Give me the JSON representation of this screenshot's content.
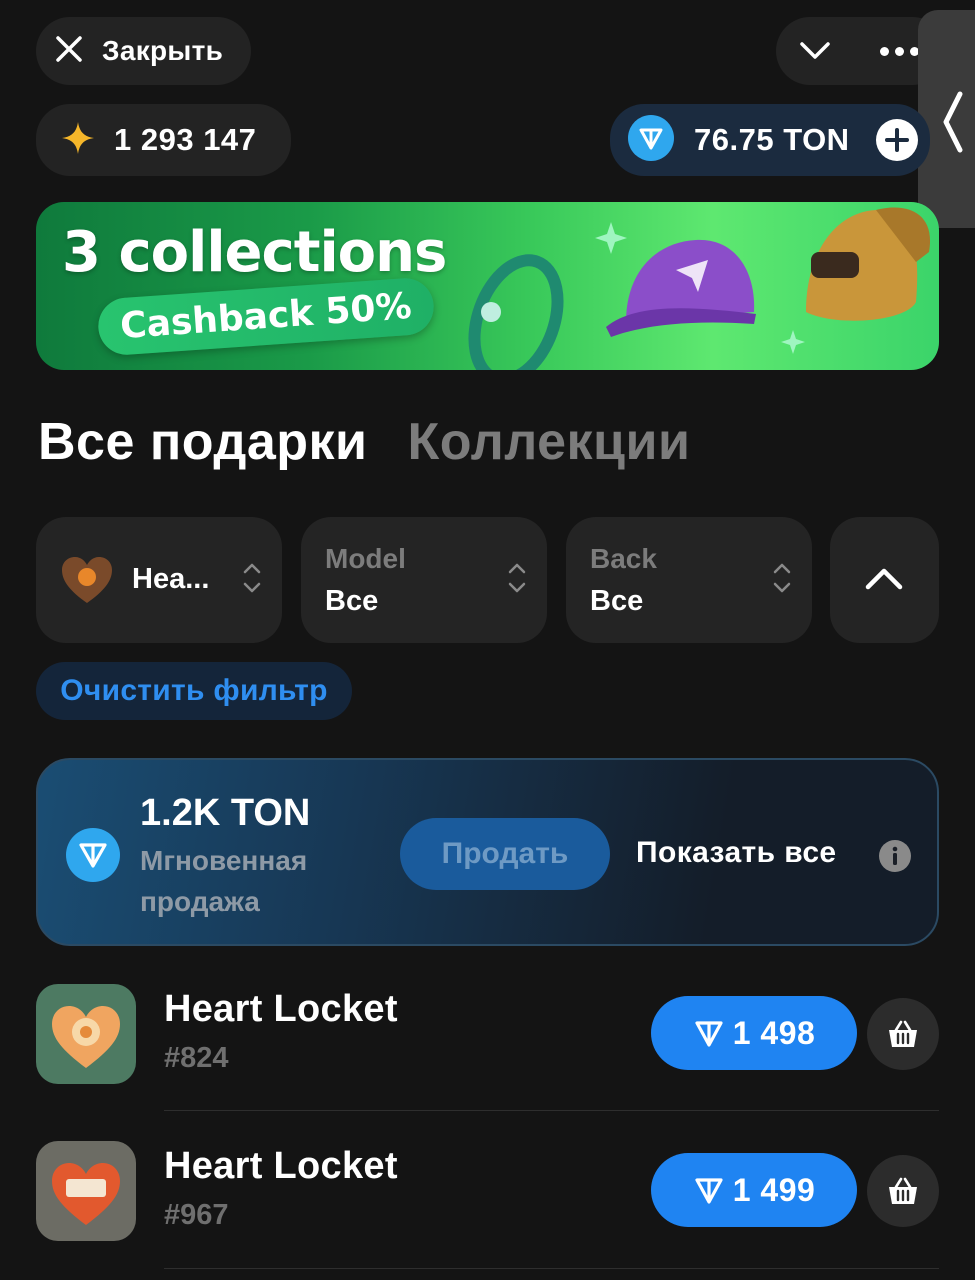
{
  "header": {
    "close_label": "Закрыть",
    "stars_balance": "1 293 147",
    "ton_balance": "76.75 TON"
  },
  "banner": {
    "title": "3 collections",
    "badge": "Cashback 50%"
  },
  "tabs": [
    {
      "label": "Все подарки",
      "active": true
    },
    {
      "label": "Коллекции",
      "active": false
    }
  ],
  "filters": {
    "collection": {
      "value": "Hea..."
    },
    "model": {
      "title": "Model",
      "value": "Все"
    },
    "back": {
      "title": "Back",
      "value": "Все"
    }
  },
  "clear_filter_label": "Очистить фильтр",
  "instant_sale": {
    "amount": "1.2K TON",
    "description": "Мгновенная продажа",
    "sell_label": "Продать",
    "show_all_label": "Показать все"
  },
  "items": [
    {
      "name": "Heart Locket",
      "number": "#824",
      "price": "1 498"
    },
    {
      "name": "Heart Locket",
      "number": "#967",
      "price": "1 499"
    }
  ],
  "colors": {
    "background": "#141414",
    "accent_blue": "#1f84f2",
    "link_blue": "#2f8ef0",
    "banner_green": "#39c95a",
    "star_gold": "#f5b62a"
  }
}
